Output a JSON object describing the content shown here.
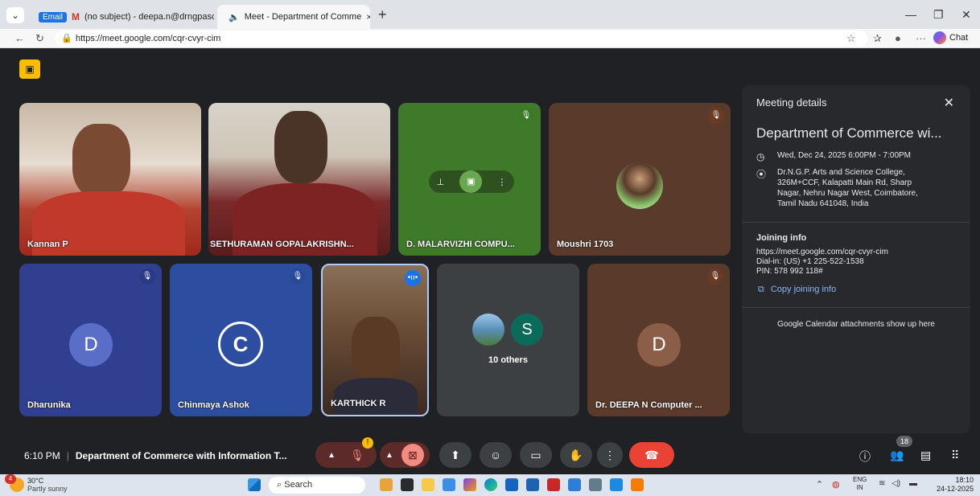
{
  "browser": {
    "tabs": [
      {
        "badge": "Email",
        "title": "(no subject) - deepa.n@drngpasc.a",
        "active": false
      },
      {
        "title": "Meet - Department of Comme",
        "active": true
      }
    ],
    "url": "https://meet.google.com/cqr-cvyr-cim",
    "chat_label": "Chat"
  },
  "participants": [
    {
      "name": "Kannan P"
    },
    {
      "name": "SETHURAMAN GOPALAKRISHN..."
    },
    {
      "name": "D. MALARVIZHI COMPU..."
    },
    {
      "name": "Moushri 1703"
    },
    {
      "name": "Dharunika",
      "initial": "D"
    },
    {
      "name": "Chinmaya Ashok",
      "initial": "C"
    },
    {
      "name": "KARTHICK R"
    },
    {
      "name": "10 others",
      "initial": "S"
    },
    {
      "name": "Dr. DEEPA N Computer ...",
      "initial": "D"
    }
  ],
  "panel": {
    "heading": "Meeting details",
    "meeting_title": "Department of Commerce wi...",
    "datetime": "Wed, Dec 24, 2025 6:00PM - 7:00PM",
    "location_lines": [
      "Dr.N.G.P. Arts and Science College,",
      "326M+CCF, Kalapatti Main Rd, Sharp",
      "Nagar, Nehru Nagar West, Coimbatore,",
      "Tamil Nadu 641048, India"
    ],
    "joining_heading": "Joining info",
    "join_url": "https://meet.google.com/cqr-cvyr-cim",
    "dial_in": "Dial-in: (US) +1 225-522-1538",
    "pin": "PIN: 578 992 118#",
    "copy_label": "Copy joining info",
    "calendar_note": "Google Calendar attachments show up here"
  },
  "bottom": {
    "time": "6:10 PM",
    "meeting_name": "Department of Commerce with Information T...",
    "people_count": "18"
  },
  "taskbar": {
    "weather_temp": "30°C",
    "weather_desc": "Partly sunny",
    "weather_badge": "4",
    "search_label": "Search",
    "lang": "ENG",
    "region": "IN",
    "clock_time": "18:10",
    "clock_date": "24-12-2025"
  }
}
